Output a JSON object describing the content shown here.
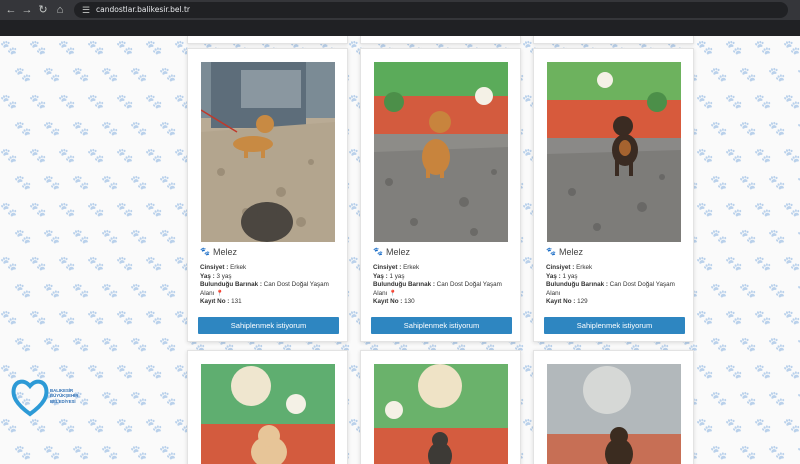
{
  "browser": {
    "url": "candostlar.balikesir.bel.tr"
  },
  "cards": [
    {
      "breed": "Melez",
      "gender_label": "Cinsiyet :",
      "gender": "Erkek",
      "age_label": "Yaş :",
      "age": "3 yaş",
      "shelter_label": "Bulunduğu Barınak :",
      "shelter": "Can Dost Doğal Yaşam Alanı",
      "record_label": "Kayıt No :",
      "record": "131",
      "button": "Sahiplenmek istiyorum"
    },
    {
      "breed": "Melez",
      "gender_label": "Cinsiyet :",
      "gender": "Erkek",
      "age_label": "Yaş :",
      "age": "1 yaş",
      "shelter_label": "Bulunduğu Barınak :",
      "shelter": "Can Dost Doğal Yaşam Alanı",
      "record_label": "Kayıt No :",
      "record": "130",
      "button": "Sahiplenmek istiyorum"
    },
    {
      "breed": "Melez",
      "gender_label": "Cinsiyet :",
      "gender": "Erkek",
      "age_label": "Yaş :",
      "age": "1 yaş",
      "shelter_label": "Bulunduğu Barınak :",
      "shelter": "Can Dost Doğal Yaşam Alanı",
      "record_label": "Kayıt No :",
      "record": "129",
      "button": "Sahiplenmek istiyorum"
    }
  ],
  "logo": {
    "line1": "BALIKESİR",
    "line2": "BÜYÜKŞEHİR",
    "line3": "BELEDİYESİ"
  },
  "colors": {
    "button": "#2e86c1",
    "paw_icon": "#2e8bc9",
    "logo": "#2d6fb5"
  }
}
